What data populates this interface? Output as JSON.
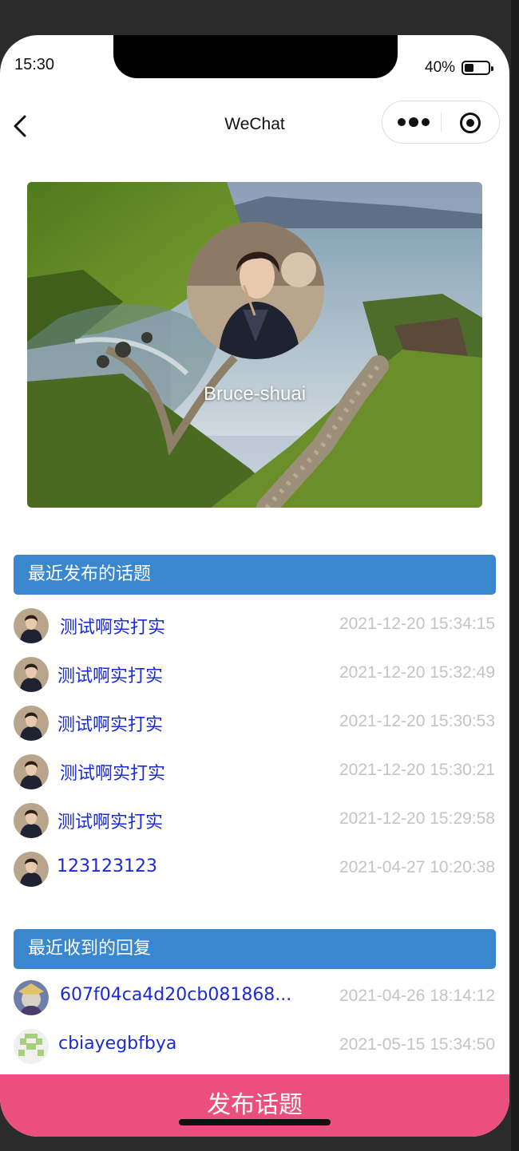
{
  "status": {
    "time": "15:30",
    "battery": "40%",
    "battery_level": 0.4
  },
  "nav": {
    "title": "WeChat"
  },
  "profile": {
    "name": "Bruce-shuai"
  },
  "sections": {
    "topics_header": "最近发布的话题",
    "replies_header": "最近收到的回复"
  },
  "topics": [
    {
      "title": "测试啊实打实",
      "time": "2021-12-20 15:34:15"
    },
    {
      "title": "测试啊实打实",
      "time": "2021-12-20 15:32:49"
    },
    {
      "title": "测试啊实打实",
      "time": "2021-12-20 15:30:53"
    },
    {
      "title": "测试啊实打实",
      "time": "2021-12-20 15:30:21"
    },
    {
      "title": "测试啊实打实",
      "time": "2021-12-20 15:29:58"
    },
    {
      "title": "123123123",
      "time": "2021-04-27 10:20:38"
    }
  ],
  "replies": [
    {
      "title": "607f04ca4d20cb081868...",
      "time": "2021-04-26 18:14:12"
    },
    {
      "title": "cbiayegbfbya",
      "time": "2021-05-15 15:34:50"
    }
  ],
  "footer": {
    "publish_label": "发布话题"
  },
  "colors": {
    "header_blue": "#3a87cf",
    "link_blue": "#1a2bd4",
    "publish_pink": "#eb4f7e"
  }
}
